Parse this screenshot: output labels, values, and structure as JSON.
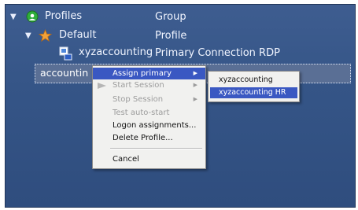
{
  "tree": {
    "profiles": {
      "label": "Profiles",
      "type": "Group",
      "icon": "globe-icon"
    },
    "default": {
      "label": "Default",
      "type": "Profile",
      "icon": "star-icon"
    },
    "connection": {
      "label": "xyzaccounting",
      "type": "Primary Connection RDP",
      "icon": "rdp-connection-icon"
    },
    "selected": {
      "label": "accountin"
    }
  },
  "context_menu": {
    "items": [
      {
        "label": "Assign primary",
        "state": "highlighted",
        "submenu": true
      },
      {
        "label": "Start Session",
        "state": "disabled",
        "submenu": true
      },
      {
        "label": "Stop Session",
        "state": "disabled",
        "submenu": true
      },
      {
        "label": "Test auto-start",
        "state": "disabled",
        "submenu": false
      },
      {
        "label": "Logon assignments...",
        "state": "enabled",
        "submenu": false
      },
      {
        "label": "Delete Profile...",
        "state": "enabled",
        "submenu": false
      },
      {
        "label": "Cancel",
        "state": "enabled",
        "submenu": false
      }
    ]
  },
  "submenu": {
    "items": [
      {
        "label": "xyzaccounting",
        "state": "normal"
      },
      {
        "label": "xyzaccounting HR",
        "state": "highlighted"
      }
    ]
  },
  "colors": {
    "background": "#355587",
    "menu_highlight": "#3a58c2",
    "menu_background": "#f1f1ef"
  }
}
